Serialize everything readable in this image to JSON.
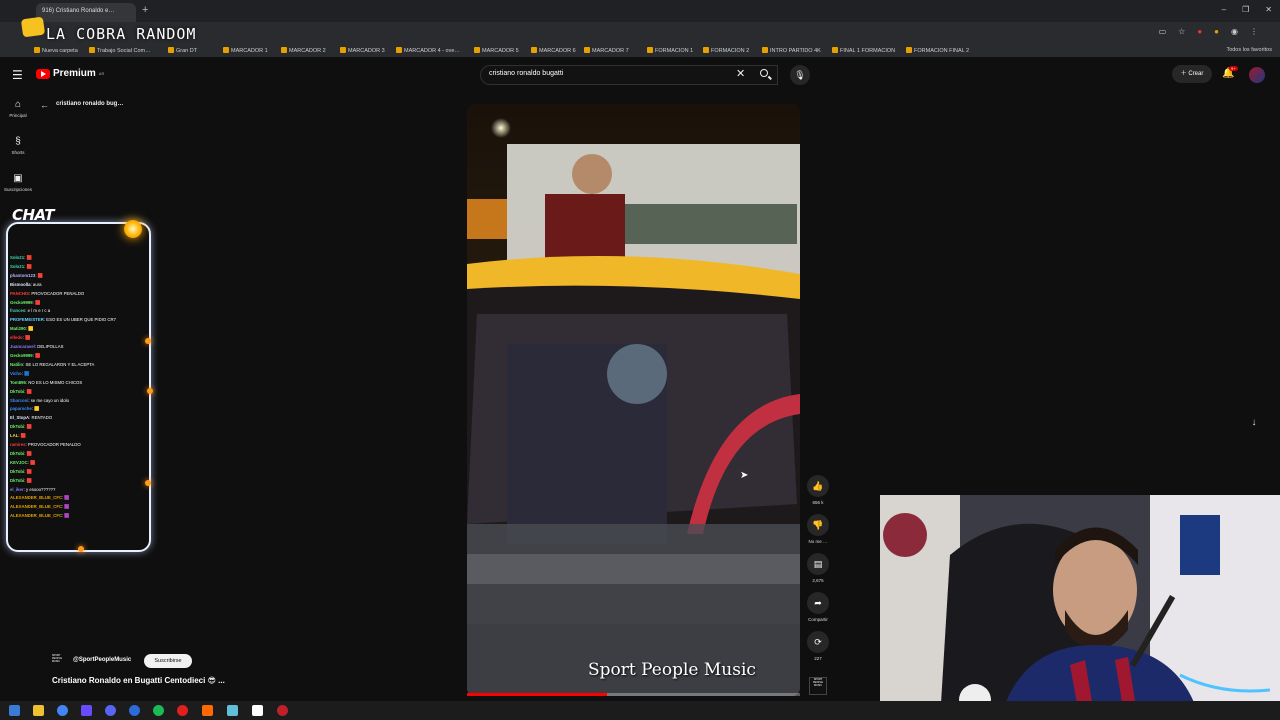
{
  "browser": {
    "tab_title": "916) Cristiano Ronaldo e…",
    "new_tab": "+",
    "window_controls": [
      "–",
      "❐",
      "✕"
    ],
    "bookmarks": [
      "Nueva carpeta",
      "Trabajo Social Com…",
      "Gran DT",
      "MARCADOR 1",
      "MARCADOR 2",
      "MARCADOR 3",
      "MARCADOR 4 - ove…",
      "MARCADOR 5",
      "MARCADOR 6",
      "MARCADOR 7",
      "FORMACION 1",
      "FORMACION 2",
      "INTRO PARTIDO 4K",
      "FINAL 1 FORMACION",
      "FORMACION FINAL 2"
    ],
    "all_favorites": "Todos los favoritos"
  },
  "overlay": {
    "stream_title": "LA COBRA RANDOM",
    "chat_header": "CHAT"
  },
  "header": {
    "logo_text": "Premium",
    "logo_sup": "AR",
    "search_value": "cristiano ronaldo bugatti",
    "create_label": "Crear",
    "notif_badge": "9+"
  },
  "nav": {
    "items": [
      {
        "icon": "⌂",
        "label": "Principal"
      },
      {
        "icon": "§",
        "label": "Shorts"
      },
      {
        "icon": "▣",
        "label": "Suscripciones"
      }
    ],
    "back_title": "cristiano ronaldo bug…"
  },
  "chat": [
    {
      "user": "Solo21",
      "msg": ": 🟥",
      "color": "#3dd9b0"
    },
    {
      "user": "Solo21",
      "msg": ": 🟥",
      "color": "#3dd9b0"
    },
    {
      "user": "phantom123",
      "msg": ": 🟥",
      "color": "#bdb8ff"
    },
    {
      "user": "Bismoolla",
      "msg": ": aura",
      "color": "#dfe3ff"
    },
    {
      "user": "PANCHIS",
      "msg": ": PROVOCADOR PENALDO",
      "color": "#ff3b3b"
    },
    {
      "user": "Gecko9999",
      "msg": ": 🟥",
      "color": "#6cf06c"
    },
    {
      "user": "frances",
      "msg": ": e l m e r c a",
      "color": "#3dd9b0"
    },
    {
      "user": "PROFEMEISTER",
      "msg": ": ESO ES UN UBER QUE PIDIO CR7",
      "color": "#60d0ff"
    },
    {
      "user": "Mati290",
      "msg": ": 🟨",
      "color": "#6cf06c"
    },
    {
      "user": "elfedo",
      "msg": ": 🟥",
      "color": "#ff3b3b"
    },
    {
      "user": "Juancaravel",
      "msg": ": DELIPOLLAS",
      "color": "#8a7dff"
    },
    {
      "user": "Gecko9999",
      "msg": ": 🟥",
      "color": "#6cf06c"
    },
    {
      "user": "Natilin",
      "msg": ": SE LO REGALARON Y EL ACEPTA",
      "color": "#6cf06c"
    },
    {
      "user": "Vicho",
      "msg": ": 🟦",
      "color": "#3d8bff"
    },
    {
      "user": "Tom895",
      "msg": ": NO ES LO MISMO CHICOS",
      "color": "#6cf06c"
    },
    {
      "user": "DkTobi",
      "msg": ": 🟥",
      "color": "#6cf06c"
    },
    {
      "user": "Sbarconi",
      "msg": ": se me cayo un idolo",
      "color": "#3d8bff"
    },
    {
      "user": "paparoche",
      "msg": ": 🟨",
      "color": "#3d8bff"
    },
    {
      "user": "El_StopA",
      "msg": ": RENTADO",
      "color": "#dfe3ff"
    },
    {
      "user": "DkTobi",
      "msg": ": 🟥",
      "color": "#6cf06c"
    },
    {
      "user": "LAL",
      "msg": ": 🟥",
      "color": "#f2e84b"
    },
    {
      "user": "ramires",
      "msg": ": PROVOCADOR PENALDO",
      "color": "#ff3b3b"
    },
    {
      "user": "DkTobi",
      "msg": ": 🟥",
      "color": "#6cf06c"
    },
    {
      "user": "KEVJOC",
      "msg": ": 🟥",
      "color": "#6cf06c"
    },
    {
      "user": "DkTobi",
      "msg": ": 🟥",
      "color": "#6cf06c"
    },
    {
      "user": "DkTobi",
      "msg": ": 🟥",
      "color": "#6cf06c"
    },
    {
      "user": "el_iker",
      "msg": ": y esooo??????",
      "color": "#8a7dff"
    },
    {
      "user": "ALEXANDER_BLUE_CFC",
      "msg": ": 🟪",
      "color": "#e6a100"
    },
    {
      "user": "ALEXANDER_BLUE_CFC",
      "msg": ": 🟪",
      "color": "#e6a100"
    },
    {
      "user": "ALEXANDER_BLUE_CFC",
      "msg": ": 🟪",
      "color": "#e6a100"
    }
  ],
  "video": {
    "channel_logo": "SPORT PEOPLE MUSIC",
    "channel": "@SportPeopleMusic",
    "subscribe": "Suscribirse",
    "title": "Cristiano Ronaldo en Bugatti Centodieci 😎 ...",
    "watermark": "Sport People Music",
    "progress": 0.42
  },
  "actions": {
    "like": "656 k",
    "dislike": "No me …",
    "comments": "2,675",
    "share": "Compartir",
    "remix": "227"
  },
  "colors": {
    "accent": "#ff0000",
    "bg": "#0f0f0f"
  }
}
